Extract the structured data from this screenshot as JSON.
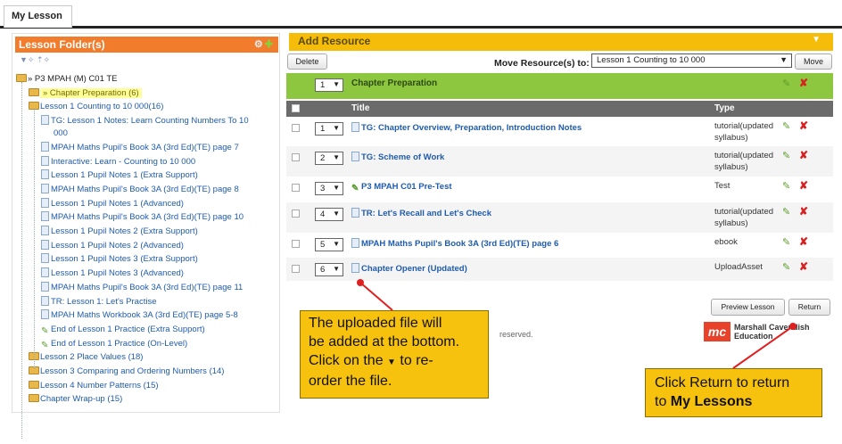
{
  "tabs": {
    "my_lesson": "My Lesson"
  },
  "left_panel": {
    "title": "Lesson Folder(s)",
    "tree": [
      {
        "label": "» P3 MPAH (M) C01 TE",
        "kind": "root"
      },
      {
        "label": "» Chapter Preparation (6)",
        "kind": "folder-hl"
      },
      {
        "label": "Lesson 1 Counting to 10 000(16)",
        "kind": "folder"
      },
      {
        "label": "TG: Lesson 1 Notes: Learn Counting Numbers To 10",
        "kind": "file"
      },
      {
        "label": "000",
        "kind": "cont"
      },
      {
        "label": "MPAH Maths Pupil's Book 3A (3rd Ed)(TE) page 7",
        "kind": "file"
      },
      {
        "label": "Interactive: Learn - Counting to 10 000",
        "kind": "file"
      },
      {
        "label": "Lesson 1 Pupil Notes 1 (Extra Support)",
        "kind": "file"
      },
      {
        "label": "MPAH Maths Pupil's Book 3A (3rd Ed)(TE) page 8",
        "kind": "file"
      },
      {
        "label": "Lesson 1 Pupil Notes 1 (Advanced)",
        "kind": "file"
      },
      {
        "label": "MPAH Maths Pupil's Book 3A (3rd Ed)(TE) page 10",
        "kind": "file"
      },
      {
        "label": "Lesson 1 Pupil Notes 2 (Extra Support)",
        "kind": "file"
      },
      {
        "label": "Lesson 1 Pupil Notes 2 (Advanced)",
        "kind": "file"
      },
      {
        "label": "Lesson 1 Pupil Notes 3 (Extra Support)",
        "kind": "file"
      },
      {
        "label": "Lesson 1 Pupil Notes 3 (Advanced)",
        "kind": "file"
      },
      {
        "label": "MPAH Maths Pupil's Book 3A (3rd Ed)(TE) page 11",
        "kind": "file"
      },
      {
        "label": "TR: Lesson 1: Let's Practise",
        "kind": "file"
      },
      {
        "label": "MPAH Maths Workbook 3A (3rd Ed)(TE) page 5-8",
        "kind": "file"
      },
      {
        "label": "End of Lesson 1 Practice (Extra Support)",
        "kind": "test"
      },
      {
        "label": "End of Lesson 1 Practice (On-Level)",
        "kind": "test"
      },
      {
        "label": "Lesson 2 Place Values (18)",
        "kind": "folder"
      },
      {
        "label": "Lesson 3 Comparing and Ordering Numbers (14)",
        "kind": "folder"
      },
      {
        "label": "Lesson 4 Number Patterns (15)",
        "kind": "folder"
      },
      {
        "label": "Chapter Wrap-up (15)",
        "kind": "folder"
      }
    ]
  },
  "right_panel": {
    "title": "Add Resource",
    "delete_label": "Delete",
    "move_label": "Move Resource(s) to:",
    "move_value": "Lesson 1 Counting to 10 000",
    "move_button": "Move",
    "chapter_order": "1",
    "chapter_title": "Chapter Preparation",
    "header_title": "Title",
    "header_type": "Type",
    "rows": [
      {
        "order": "1",
        "title": "TG: Chapter Overview, Preparation, Introduction Notes",
        "type": "tutorial(updated syllabus)",
        "icon": "file-icon"
      },
      {
        "order": "2",
        "title": "TG: Scheme of Work",
        "type": "tutorial(updated syllabus)",
        "icon": "file-icon"
      },
      {
        "order": "3",
        "title": "P3 MPAH C01 Pre-Test",
        "type": "Test",
        "icon": "test-icon"
      },
      {
        "order": "4",
        "title": "TR: Let's Recall and Let's Check",
        "type": "tutorial(updated syllabus)",
        "icon": "file-icon"
      },
      {
        "order": "5",
        "title": "MPAH Maths Pupil's Book 3A (3rd Ed)(TE) page 6",
        "type": "ebook",
        "icon": "file-icon"
      },
      {
        "order": "6",
        "title": "Chapter Opener (Updated)",
        "type": "UploadAsset",
        "icon": "upload-icon"
      }
    ],
    "preview_button": "Preview Lesson",
    "return_button": "Return",
    "copyright_fragment": "reserved.",
    "logo_text_line1": "Marshall Cavendish",
    "logo_text_line2": "Education"
  },
  "callouts": {
    "upload_text_1": "The uploaded file will",
    "upload_text_2": "be added at the bottom.",
    "upload_text_3": "Click on the",
    "upload_text_3b": "to re-",
    "upload_text_4": "order the file.",
    "return_text_1": "Click Return to return",
    "return_text_2_prefix": "to ",
    "return_text_2_bold": "My Lessons"
  },
  "colors": {
    "orange_header": "#f07c2c",
    "yellow_header": "#f5bd0a",
    "green_bar": "#8dc63f",
    "callout": "#f7c20e",
    "arrow": "#e02020"
  }
}
